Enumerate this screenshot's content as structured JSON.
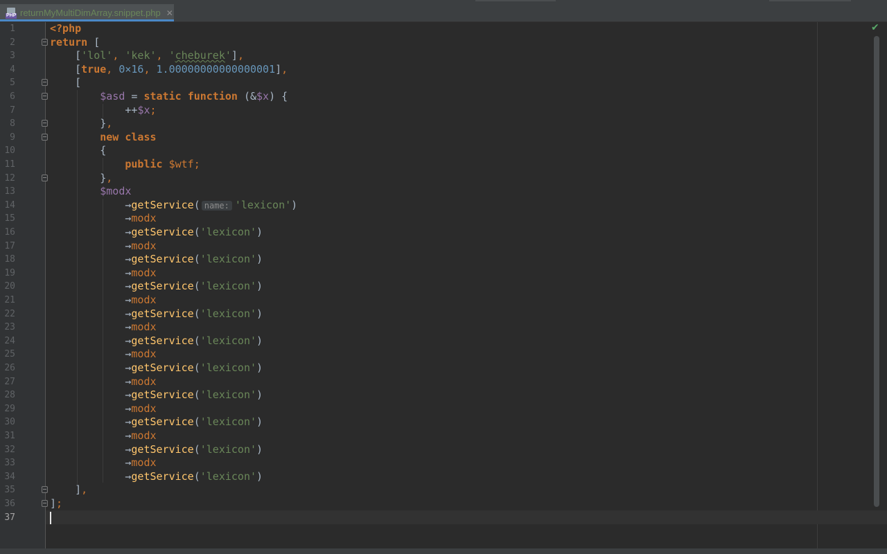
{
  "tab": {
    "icon_label": "PHP",
    "icon": "php-file-icon",
    "filename": "returnMyMultiDimArray.snippet.php",
    "close": "✕"
  },
  "status": {
    "inspection_icon": "check-icon",
    "inspection_glyph": "✔"
  },
  "colors": {
    "background": "#2b2b2b",
    "keyword": "#cc7832",
    "string": "#6a8759",
    "number": "#6897bb",
    "variable": "#9876aa",
    "method": "#ffc66d",
    "tab_underline": "#4a88c7"
  },
  "editor": {
    "current_line": 37,
    "param_hint": "name:",
    "lines": [
      {
        "n": "1"
      },
      {
        "n": "2"
      },
      {
        "n": "3"
      },
      {
        "n": "4"
      },
      {
        "n": "5"
      },
      {
        "n": "6"
      },
      {
        "n": "7"
      },
      {
        "n": "8"
      },
      {
        "n": "9"
      },
      {
        "n": "10"
      },
      {
        "n": "11"
      },
      {
        "n": "12"
      },
      {
        "n": "13"
      },
      {
        "n": "14"
      },
      {
        "n": "15"
      },
      {
        "n": "16"
      },
      {
        "n": "17"
      },
      {
        "n": "18"
      },
      {
        "n": "19"
      },
      {
        "n": "20"
      },
      {
        "n": "21"
      },
      {
        "n": "22"
      },
      {
        "n": "23"
      },
      {
        "n": "24"
      },
      {
        "n": "25"
      },
      {
        "n": "26"
      },
      {
        "n": "27"
      },
      {
        "n": "28"
      },
      {
        "n": "29"
      },
      {
        "n": "30"
      },
      {
        "n": "31"
      },
      {
        "n": "32"
      },
      {
        "n": "33"
      },
      {
        "n": "34"
      },
      {
        "n": "35"
      },
      {
        "n": "36"
      },
      {
        "n": "37"
      }
    ],
    "tokens": {
      "php_open": "<?php",
      "return_kw": "return",
      "open_bracket": "[",
      "close_bracket": "]",
      "comma": ",",
      "str_lol": "'lol'",
      "str_kek": "'kek'",
      "str_cheburek_q1": "'",
      "str_cheburek_word": "cheburek",
      "str_cheburek_q2": "'",
      "true_kw": "true",
      "hex": "0×16",
      "float": "1.00000000000000001",
      "var_asd": "$asd",
      "assign": " = ",
      "static_kw": "static",
      "function_kw": "function",
      "paren_open": "(",
      "paren_close": ")",
      "amp": "&",
      "var_x": "$x",
      "brace_open": "{",
      "brace_close": "}",
      "incr": "++",
      "semicolon": ";",
      "new_kw": "new",
      "class_kw": "class",
      "public_kw": "public",
      "var_wtf": "$wtf",
      "var_modx": "$modx",
      "arrow": "→",
      "method": "getService",
      "prop_modx": "modx",
      "str_lexicon": "'lexicon'",
      "close_stmt": "];"
    }
  }
}
